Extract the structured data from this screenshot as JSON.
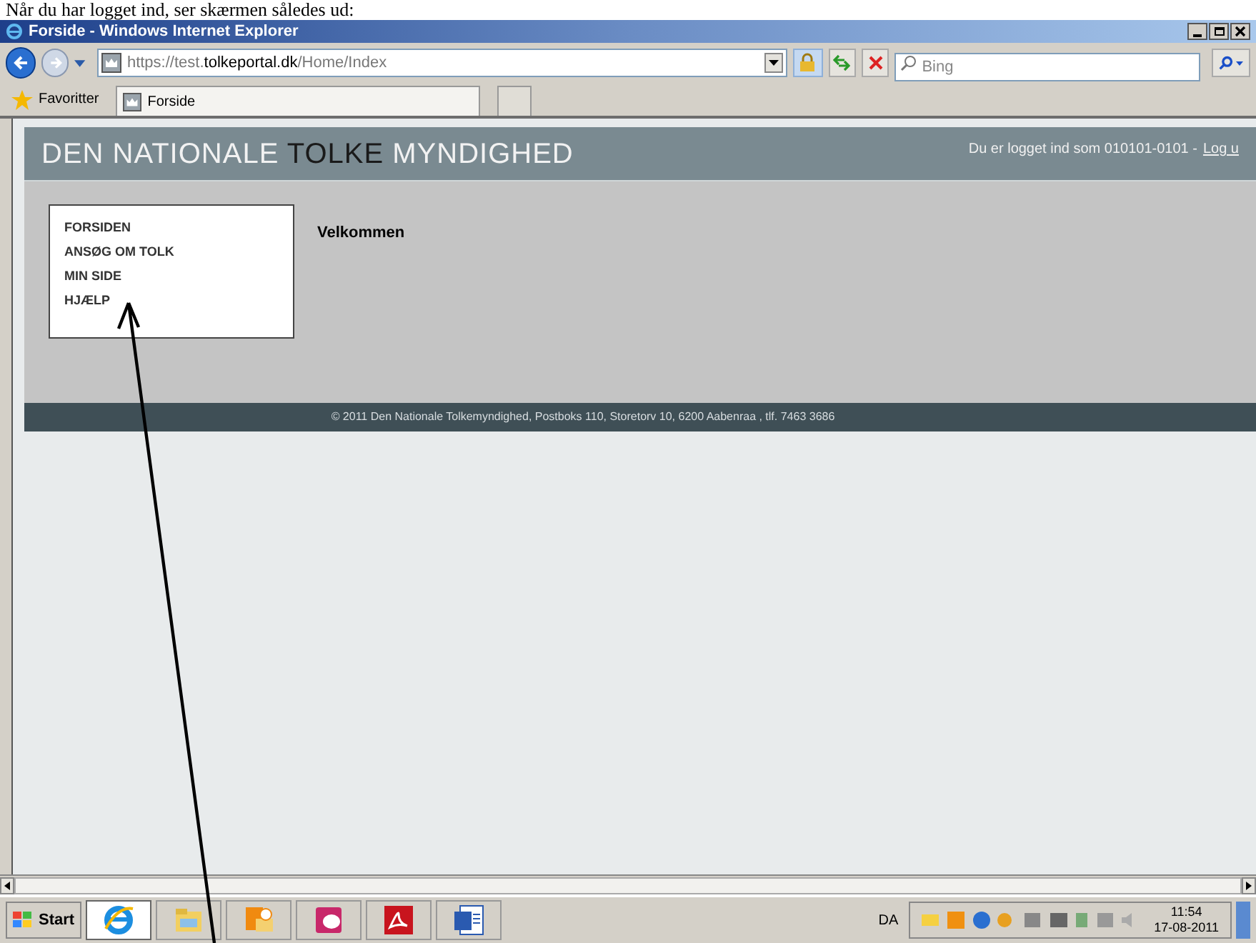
{
  "document_caption": "Når du har logget ind, ser skærmen således ud:",
  "window": {
    "title": "Forside - Windows Internet Explorer"
  },
  "address_bar": {
    "url_parts": [
      {
        "text": "https://test.",
        "highlight": false
      },
      {
        "text": "tolkeportal.dk",
        "highlight": true
      },
      {
        "text": "/Home/Index",
        "highlight": false
      }
    ],
    "search_placeholder": "Bing"
  },
  "favorites_bar": {
    "label": "Favoritter",
    "tabs": [
      {
        "label": "Forside"
      }
    ]
  },
  "page": {
    "title_parts": [
      {
        "text": "DEN NATIONALE ",
        "highlight": false
      },
      {
        "text": "TOLKE",
        "highlight": true
      },
      {
        "text": " MYNDIGHED",
        "highlight": false
      }
    ],
    "login_text": "Du er logget ind som 010101-0101 -",
    "logout_link": "Log u",
    "menu": [
      {
        "label": "FORSIDEN"
      },
      {
        "label": "ANSØG OM TOLK"
      },
      {
        "label": "MIN SIDE"
      },
      {
        "label": "HJÆLP"
      }
    ],
    "heading": "Velkommen",
    "footer": "© 2011 Den Nationale Tolkemyndighed, Postboks 110, Storetorv 10, 6200 Aabenraa , tlf. 7463 3686"
  },
  "taskbar": {
    "start": "Start",
    "apps": [
      {
        "kind": "browser",
        "selected": true
      },
      {
        "kind": "folder",
        "selected": false
      },
      {
        "kind": "mail",
        "selected": false
      },
      {
        "kind": "database",
        "selected": false
      },
      {
        "kind": "pdf",
        "selected": false
      },
      {
        "kind": "document",
        "selected": false
      }
    ],
    "language": "DA",
    "time": "11:54",
    "date": "17-08-2011"
  }
}
